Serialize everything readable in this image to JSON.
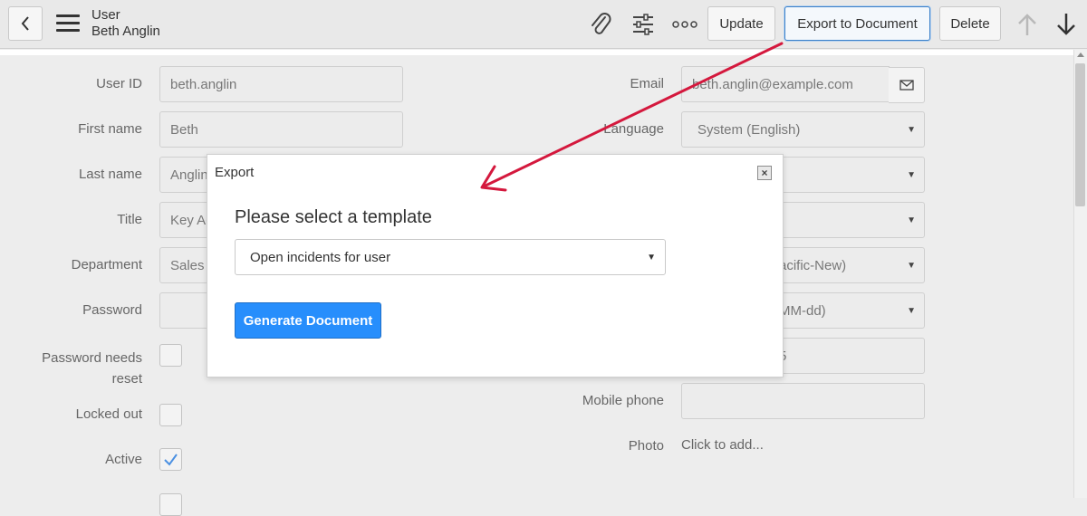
{
  "header": {
    "record_type": "User",
    "record_name": "Beth Anglin",
    "buttons": {
      "update": "Update",
      "export": "Export to Document",
      "delete": "Delete"
    },
    "icons": [
      "back-icon",
      "menu-icon",
      "attachment-icon",
      "settings-icon",
      "more-icon",
      "arrow-up-icon",
      "arrow-down-icon"
    ]
  },
  "form": {
    "left": {
      "user_id": {
        "label": "User ID",
        "value": "beth.anglin"
      },
      "first_name": {
        "label": "First name",
        "value": "Beth"
      },
      "last_name": {
        "label": "Last name",
        "value": "Anglin"
      },
      "title": {
        "label": "Title",
        "value": "Key Ac"
      },
      "department": {
        "label": "Department",
        "value": "Sales"
      },
      "password": {
        "label": "Password",
        "value": ""
      },
      "password_needs_reset": {
        "label_line1": "Password needs",
        "label_line2": "reset",
        "checked": false
      },
      "locked_out": {
        "label": "Locked out",
        "checked": false
      },
      "active": {
        "label": "Active",
        "checked": true
      }
    },
    "right": {
      "email": {
        "label": "Email",
        "value": "beth.anglin@example.com"
      },
      "language": {
        "label": "Language",
        "value": "System (English)"
      },
      "timezone": {
        "value": "acific-New)"
      },
      "date_format": {
        "value": "MM-dd)"
      },
      "business_phone": {
        "value": "5"
      },
      "mobile_phone": {
        "label": "Mobile phone",
        "value": ""
      },
      "photo": {
        "label": "Photo",
        "value": "Click to add..."
      }
    }
  },
  "modal": {
    "title": "Export",
    "heading": "Please select a template",
    "template_selected": "Open incidents for user",
    "generate_button": "Generate Document"
  },
  "colors": {
    "primary_button": "#278efc",
    "annotation_arrow": "#d4183d",
    "checkbox_check": "#4a90e2"
  }
}
